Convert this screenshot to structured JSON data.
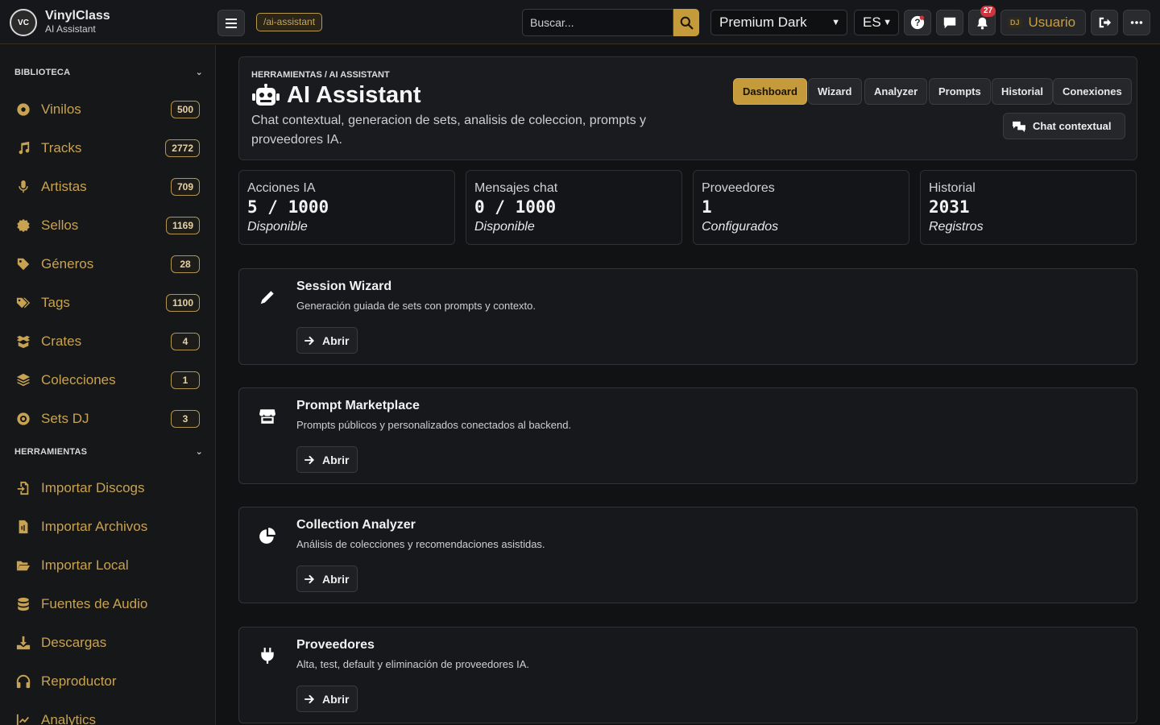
{
  "header": {
    "brand_title": "VinylClass",
    "brand_subtitle": "AI Assistant",
    "logo_text": "VC",
    "route": "/ai-assistant",
    "search_placeholder": "Buscar...",
    "theme_value": "Premium Dark",
    "lang_value": "ES",
    "notifications_count": "27",
    "user_badge": "DJ",
    "user_label": "Usuario"
  },
  "sidebar": {
    "section_library": "BIBLIOTECA",
    "library_items": [
      {
        "label": "Vinilos",
        "count": "500",
        "icon": "disc-icon"
      },
      {
        "label": "Tracks",
        "count": "2772",
        "icon": "music-note-icon"
      },
      {
        "label": "Artistas",
        "count": "709",
        "icon": "microphone-icon"
      },
      {
        "label": "Sellos",
        "count": "1169",
        "icon": "seal-icon"
      },
      {
        "label": "Géneros",
        "count": "28",
        "icon": "tag-icon"
      },
      {
        "label": "Tags",
        "count": "1100",
        "icon": "tags-icon"
      },
      {
        "label": "Crates",
        "count": "4",
        "icon": "box-icon"
      },
      {
        "label": "Colecciones",
        "count": "1",
        "icon": "layers-icon"
      },
      {
        "label": "Sets DJ",
        "count": "3",
        "icon": "record-icon"
      }
    ],
    "section_tools": "HERRAMIENTAS",
    "tool_items": [
      {
        "label": "Importar Discogs",
        "icon": "file-import-icon"
      },
      {
        "label": "Importar Archivos",
        "icon": "file-audio-icon"
      },
      {
        "label": "Importar Local",
        "icon": "folder-open-icon"
      },
      {
        "label": "Fuentes de Audio",
        "icon": "database-icon"
      },
      {
        "label": "Descargas",
        "icon": "download-icon"
      },
      {
        "label": "Reproductor",
        "icon": "headphones-icon"
      },
      {
        "label": "Analytics",
        "icon": "chart-line-icon"
      }
    ]
  },
  "hero": {
    "breadcrumb": "HERRAMIENTAS / AI ASSISTANT",
    "title": "AI Assistant",
    "description": "Chat contextual, generacion de sets, analisis de coleccion, prompts y proveedores IA.",
    "tabs": [
      "Dashboard",
      "Wizard",
      "Analyzer",
      "Prompts",
      "Historial",
      "Conexiones"
    ],
    "chat_button": "Chat contextual"
  },
  "stats": [
    {
      "label": "Acciones IA",
      "value": "5 / 1000",
      "sub": "Disponible"
    },
    {
      "label": "Mensajes chat",
      "value": "0 / 1000",
      "sub": "Disponible"
    },
    {
      "label": "Proveedores",
      "value": "1",
      "sub": "Configurados"
    },
    {
      "label": "Historial",
      "value": "2031",
      "sub": "Registros"
    }
  ],
  "cards": [
    {
      "title": "Session Wizard",
      "desc": "Generación guiada de sets con prompts y contexto.",
      "button": "Abrir",
      "icon": "pencil-icon"
    },
    {
      "title": "Prompt Marketplace",
      "desc": "Prompts públicos y personalizados conectados al backend.",
      "button": "Abrir",
      "icon": "store-icon"
    },
    {
      "title": "Collection Analyzer",
      "desc": "Análisis de colecciones y recomendaciones asistidas.",
      "button": "Abrir",
      "icon": "pie-chart-icon"
    },
    {
      "title": "Proveedores",
      "desc": "Alta, test, default y eliminación de proveedores IA.",
      "button": "Abrir",
      "icon": "plug-icon"
    }
  ],
  "colors": {
    "accent": "#c49a3a",
    "sidebar_text": "#c8a253",
    "background": "#111214",
    "danger_badge": "#d0343d"
  }
}
